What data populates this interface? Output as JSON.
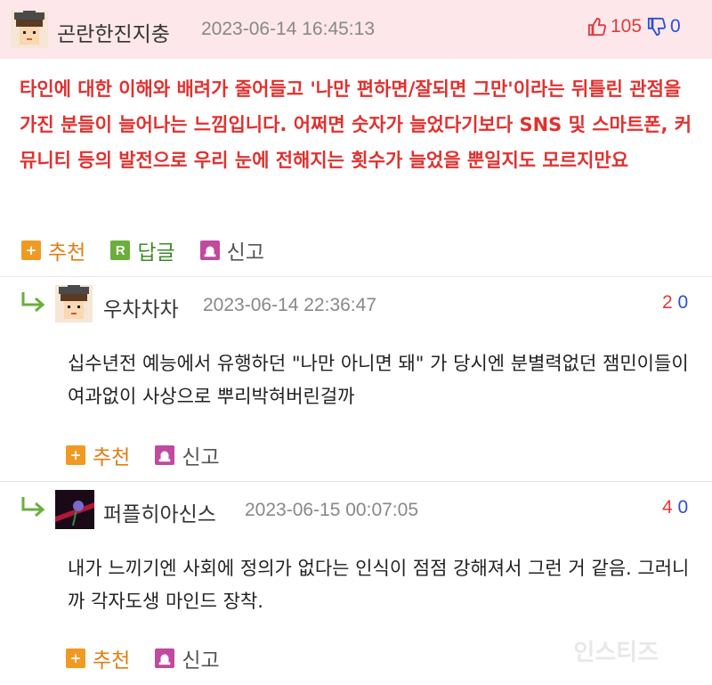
{
  "best_comment": {
    "author": "곤란한진지충",
    "date": "2023-06-14 16:45:13",
    "upvotes": "105",
    "downvotes": "0",
    "text": "타인에 대한 이해와 배려가 줄어들고 '나만 편하면/잘되면 그만'이라는 뒤틀린 관점을 가진 분들이 늘어나는 느낌입니다. 어쩌면 숫자가 늘었다기보다 SNS 및 스마트폰, 커뮤니티 등의 발전으로 우리 눈에 전해지는 횟수가 늘었을 뿐일지도 모르지만요",
    "actions": {
      "recommend": "추천",
      "reply": "답글",
      "report": "신고"
    }
  },
  "replies": [
    {
      "author": "우차차차",
      "date": "2023-06-14 22:36:47",
      "upvotes": "2",
      "downvotes": "0",
      "text": "십수년전 예능에서 유행하던 \"나만 아니면 돼\" 가 당시엔 분별력없던 잼민이들이 여과없이 사상으로 뿌리박혀버린걸까",
      "actions": {
        "recommend": "추천",
        "report": "신고"
      }
    },
    {
      "author": "퍼플히아신스",
      "date": "2023-06-15 00:07:05",
      "upvotes": "4",
      "downvotes": "0",
      "text": "내가 느끼기엔 사회에 정의가 없다는 인식이 점점 강해져서 그런 거 같음. 그러니까 각자도생 마인드 장착.",
      "actions": {
        "recommend": "추천",
        "report": "신고"
      }
    }
  ],
  "watermark": "인스티즈",
  "icons": {
    "thumbs_up": "thumbs-up-icon",
    "thumbs_down": "thumbs-down-icon",
    "reply_arrow": "reply-arrow-icon",
    "plus": "plus-icon",
    "reply_r": "reply-r-icon",
    "report": "report-siren-icon"
  },
  "colors": {
    "header_bg": "#fde7ea",
    "best_text": "#e0312f",
    "upvote": "#e03a3a",
    "downvote": "#2a4fd6",
    "recommend": "#e07e12",
    "reply": "#3f8a2a"
  }
}
